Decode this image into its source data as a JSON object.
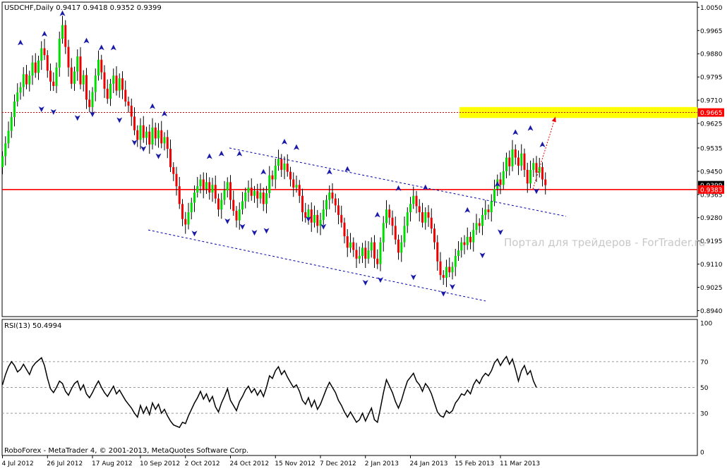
{
  "window": {
    "symbol_header": "USDCHF,Daily  0.9417 0.9418 0.9352 0.9399",
    "footer": "RoboForex - MetaTrader 4, © 2001-2013, MetaQuotes Software Corp.",
    "watermark": "Портал для трейдеров - ForTrader.ru"
  },
  "colors": {
    "background": "#ffffff",
    "frame": "#000000",
    "bull_candle": "#00dd00",
    "bear_candle": "#ee0000",
    "wick": "#000000",
    "fractal": "#1a1aa8",
    "channel": "#0000aa",
    "support_line": "#ff0000",
    "resistance_line": "#dd0000",
    "target_zone": "#ffff00",
    "arrow": "#ee0000",
    "price_label_bg": "#ff0000",
    "current_label_bg": "#000000",
    "watermark": "#c8c8c8",
    "rsi_line": "#000000",
    "rsi_levels": "#9a9a9a"
  },
  "chart_data": [
    {
      "type": "candlestick",
      "symbol": "USDCHF",
      "timeframe": "Daily",
      "ohlc_last": {
        "open": 0.9417,
        "high": 0.9418,
        "low": 0.9352,
        "close": 0.9399
      },
      "ylim": [
        0.8918,
        1.0069
      ],
      "y_ticks": [
        "1.0050",
        "0.9965",
        "0.9880",
        "0.9795",
        "0.9710",
        "0.9625",
        "0.9535",
        "0.9450",
        "0.9365",
        "0.9280",
        "0.9195",
        "0.9110",
        "0.9025",
        "0.8940"
      ],
      "x_ticks": [
        "4 Jul 2012",
        "26 Jul 2012",
        "17 Aug 2012",
        "10 Sep 2012",
        "2 Oct 2012",
        "24 Oct 2012",
        "15 Nov 2012",
        "7 Dec 2012",
        "2 Jan 2013",
        "24 Jan 2013",
        "15 Feb 2013",
        "11 Mar 2013"
      ],
      "levels": [
        {
          "label": "0.9665",
          "price": 0.9665,
          "style": "dashed"
        },
        {
          "label": "0.9383",
          "price": 0.9383,
          "style": "solid"
        }
      ],
      "current_price_label": "0.9399",
      "target_zone": {
        "low": 0.9645,
        "high": 0.9685
      },
      "channel": {
        "upper": {
          "from": [
            "10 Oct 2012",
            0.9535
          ],
          "to": [
            "28 Mar 2013",
            0.9285
          ]
        },
        "lower": {
          "from": [
            "10 Sep 2012",
            0.9235
          ],
          "to": [
            "26 Feb 2013",
            0.8975
          ]
        }
      },
      "projection_arrow": {
        "from": [
          "19 Mar 2013",
          0.9385
        ],
        "to": [
          "26 Mar 2013",
          0.965
        ]
      },
      "closes": [
        0.9505,
        0.9552,
        0.9598,
        0.9648,
        0.9705,
        0.9738,
        0.9758,
        0.9805,
        0.9768,
        0.98,
        0.9848,
        0.981,
        0.9855,
        0.99,
        0.9875,
        0.9818,
        0.9778,
        0.9762,
        0.983,
        0.9935,
        0.9985,
        0.9905,
        0.983,
        0.977,
        0.9815,
        0.987,
        0.9768,
        0.9802,
        0.9712,
        0.9685,
        0.974,
        0.98,
        0.9858,
        0.9812,
        0.9752,
        0.9715,
        0.977,
        0.98,
        0.9745,
        0.979,
        0.9748,
        0.9705,
        0.969,
        0.965,
        0.96,
        0.9565,
        0.9618,
        0.9572,
        0.9595,
        0.9548,
        0.961,
        0.957,
        0.96,
        0.9552,
        0.9575,
        0.9532,
        0.9465,
        0.944,
        0.9395,
        0.933,
        0.9275,
        0.9255,
        0.93,
        0.9335,
        0.9372,
        0.9395,
        0.942,
        0.9385,
        0.941,
        0.9372,
        0.94,
        0.935,
        0.931,
        0.9345,
        0.938,
        0.941,
        0.9345,
        0.9305,
        0.927,
        0.931,
        0.934,
        0.9372,
        0.939,
        0.936,
        0.9378,
        0.935,
        0.9372,
        0.933,
        0.937,
        0.9435,
        0.942,
        0.947,
        0.9495,
        0.9455,
        0.9478,
        0.9448,
        0.942,
        0.939,
        0.94,
        0.936,
        0.93,
        0.928,
        0.931,
        0.9262,
        0.929,
        0.925,
        0.9272,
        0.931,
        0.9345,
        0.9372,
        0.935,
        0.9325,
        0.929,
        0.9262,
        0.9212,
        0.917,
        0.919,
        0.9162,
        0.913,
        0.914,
        0.917,
        0.913,
        0.916,
        0.919,
        0.913,
        0.911,
        0.919,
        0.926,
        0.931,
        0.928,
        0.925,
        0.92,
        0.9152,
        0.919,
        0.925,
        0.93,
        0.933,
        0.936,
        0.9322,
        0.93,
        0.9262,
        0.93,
        0.928,
        0.924,
        0.919,
        0.912,
        0.907,
        0.906,
        0.91,
        0.908,
        0.91,
        0.914,
        0.916,
        0.919,
        0.918,
        0.921,
        0.919,
        0.9235,
        0.926,
        0.925,
        0.929,
        0.931,
        0.93,
        0.934,
        0.9385,
        0.942,
        0.94,
        0.945,
        0.95,
        0.9468,
        0.953,
        0.95,
        0.947,
        0.9515,
        0.9455,
        0.9405,
        0.9455,
        0.948,
        0.9445,
        0.9465,
        0.942,
        0.9399
      ],
      "fractals_up": [
        [
          6,
          0.9898
        ],
        [
          14,
          0.993
        ],
        [
          20,
          1.0005
        ],
        [
          28,
          0.9905
        ],
        [
          33,
          0.988
        ],
        [
          37,
          0.988
        ],
        [
          50,
          0.9665
        ],
        [
          54,
          0.9638
        ],
        [
          69,
          0.9482
        ],
        [
          73,
          0.9492
        ],
        [
          79,
          0.9492
        ],
        [
          87,
          0.9425
        ],
        [
          94,
          0.9535
        ],
        [
          98,
          0.9515
        ],
        [
          109,
          0.9425
        ],
        [
          115,
          0.9435
        ],
        [
          125,
          0.9268
        ],
        [
          132,
          0.9365
        ],
        [
          141,
          0.9368
        ],
        [
          155,
          0.9285
        ],
        [
          165,
          0.938
        ],
        [
          171,
          0.957
        ],
        [
          176,
          0.9585
        ],
        [
          180,
          0.9525
        ]
      ],
      "fractals_down": [
        [
          13,
          0.97
        ],
        [
          17,
          0.969
        ],
        [
          25,
          0.9668
        ],
        [
          30,
          0.9682
        ],
        [
          39,
          0.966
        ],
        [
          44,
          0.9578
        ],
        [
          47,
          0.9555
        ],
        [
          52,
          0.9528
        ],
        [
          64,
          0.9245
        ],
        [
          75,
          0.929
        ],
        [
          80,
          0.927
        ],
        [
          84,
          0.9248
        ],
        [
          88,
          0.9255
        ],
        [
          102,
          0.9298
        ],
        [
          107,
          0.927
        ],
        [
          121,
          0.9065
        ],
        [
          126,
          0.9075
        ],
        [
          137,
          0.9085
        ],
        [
          147,
          0.9025
        ],
        [
          150,
          0.905
        ],
        [
          160,
          0.9165
        ],
        [
          166,
          0.925
        ],
        [
          178,
          0.94
        ]
      ]
    },
    {
      "type": "line",
      "indicator": "RSI(13)",
      "header": "RSI(13) 50.4994",
      "ylim": [
        0,
        100
      ],
      "y_ticks": [
        "100",
        "70",
        "50",
        "30",
        "0"
      ],
      "levels": [
        70,
        50,
        30
      ],
      "values": [
        52,
        60,
        66,
        70,
        67,
        62,
        64,
        68,
        64,
        60,
        66,
        69,
        71,
        73,
        67,
        57,
        49,
        46,
        50,
        55,
        53,
        47,
        44,
        49,
        53,
        55,
        48,
        52,
        45,
        42,
        46,
        51,
        55,
        50,
        46,
        43,
        47,
        51,
        45,
        48,
        44,
        40,
        37,
        34,
        30,
        27,
        36,
        30,
        35,
        29,
        38,
        33,
        37,
        30,
        33,
        28,
        24,
        21,
        20,
        19,
        23,
        22,
        28,
        33,
        38,
        42,
        47,
        41,
        45,
        39,
        43,
        35,
        31,
        38,
        43,
        49,
        40,
        36,
        32,
        39,
        43,
        48,
        51,
        46,
        49,
        44,
        48,
        43,
        50,
        59,
        57,
        63,
        66,
        60,
        63,
        58,
        54,
        50,
        52,
        47,
        40,
        37,
        42,
        35,
        40,
        33,
        37,
        43,
        49,
        54,
        50,
        46,
        40,
        36,
        31,
        27,
        31,
        27,
        23,
        25,
        30,
        24,
        29,
        34,
        25,
        23,
        34,
        46,
        56,
        51,
        46,
        39,
        34,
        40,
        48,
        55,
        58,
        61,
        55,
        52,
        47,
        53,
        50,
        45,
        38,
        31,
        28,
        27,
        32,
        30,
        32,
        38,
        41,
        45,
        44,
        48,
        45,
        52,
        56,
        53,
        58,
        61,
        59,
        63,
        69,
        72,
        67,
        71,
        74,
        68,
        72,
        64,
        55,
        63,
        67,
        60,
        63,
        55,
        50
      ]
    }
  ]
}
